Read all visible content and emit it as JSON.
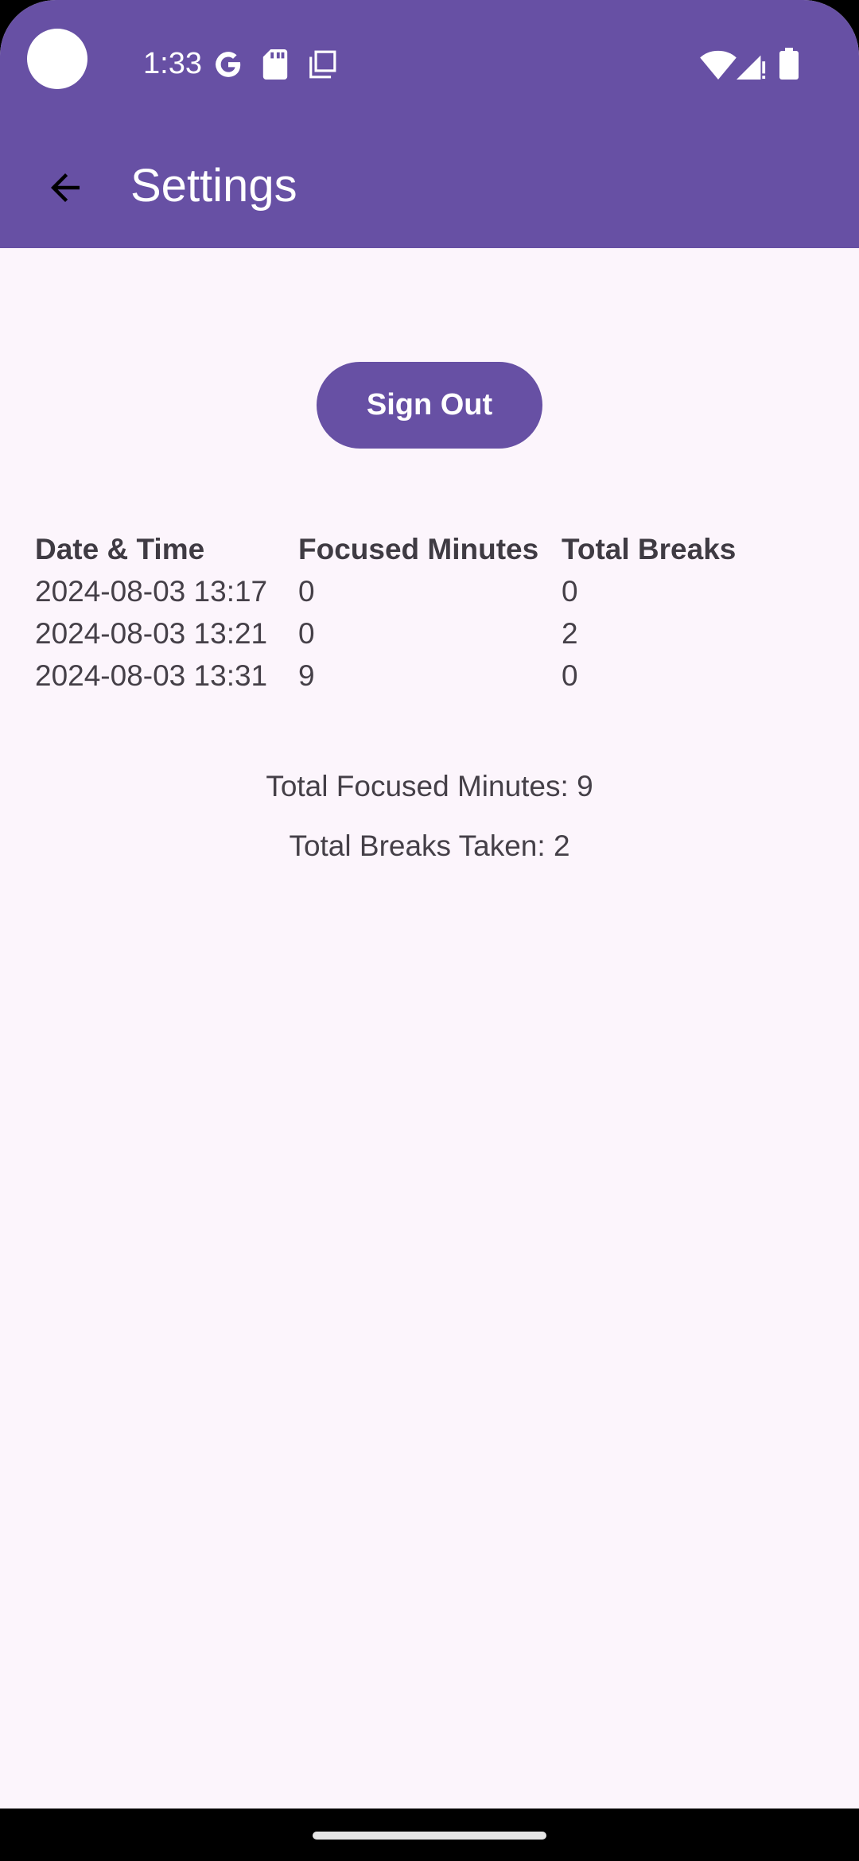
{
  "status_bar": {
    "time": "1:33",
    "icons": [
      "google-icon",
      "sd-card-icon",
      "copy-icon",
      "wifi-icon",
      "signal-icon",
      "battery-icon"
    ]
  },
  "app_bar": {
    "title": "Settings",
    "back_icon": "arrow-back-icon"
  },
  "actions": {
    "sign_out_label": "Sign Out"
  },
  "table": {
    "headers": [
      "Date & Time",
      "Focused Minutes",
      "Total Breaks"
    ],
    "rows": [
      [
        "2024-08-03 13:17",
        "0",
        "0"
      ],
      [
        "2024-08-03 13:21",
        "0",
        "2"
      ],
      [
        "2024-08-03 13:31",
        "9",
        "0"
      ]
    ]
  },
  "summary": {
    "total_focused": "Total Focused Minutes: 9",
    "total_breaks": "Total Breaks Taken: 2"
  },
  "colors": {
    "primary": "#6750A4",
    "background": "#FCF5FC",
    "text": "#454048"
  }
}
